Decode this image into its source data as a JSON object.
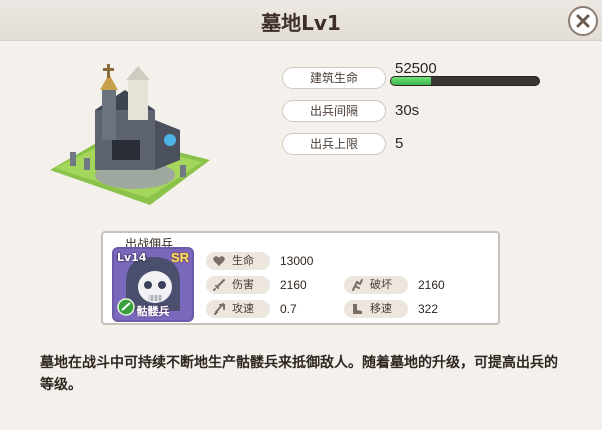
{
  "dialog": {
    "title": "墓地Lv1",
    "close_icon": "close-icon"
  },
  "building_stats": [
    {
      "label": "建筑生命",
      "value": "52500",
      "fill_fraction": 0.27
    },
    {
      "label": "出兵间隔",
      "value": "30s"
    },
    {
      "label": "出兵上限",
      "value": "5"
    }
  ],
  "unit": {
    "heading": "出战佣兵",
    "level": "Lv14",
    "rarity": "SR",
    "name": "骷髅兵",
    "stats": {
      "hp": {
        "label": "生命",
        "value": "13000",
        "icon": "heart-icon"
      },
      "damage": {
        "label": "伤害",
        "value": "2160",
        "icon": "sword-icon"
      },
      "attack_speed": {
        "label": "攻速",
        "value": "0.7",
        "icon": "attack-speed-icon"
      },
      "destroy": {
        "label": "破坏",
        "value": "2160",
        "icon": "destroy-icon"
      },
      "move_speed": {
        "label": "移速",
        "value": "322",
        "icon": "boot-icon"
      }
    }
  },
  "description": "墓地在战斗中可持续不断地生产骷髅兵来抵御敌人。随着墓地的升级，可提高出兵的等级。",
  "colors": {
    "hp_fill": "#3cb548",
    "rarity_text": "#ffe45c",
    "portrait_bg": "#7a68bc"
  }
}
